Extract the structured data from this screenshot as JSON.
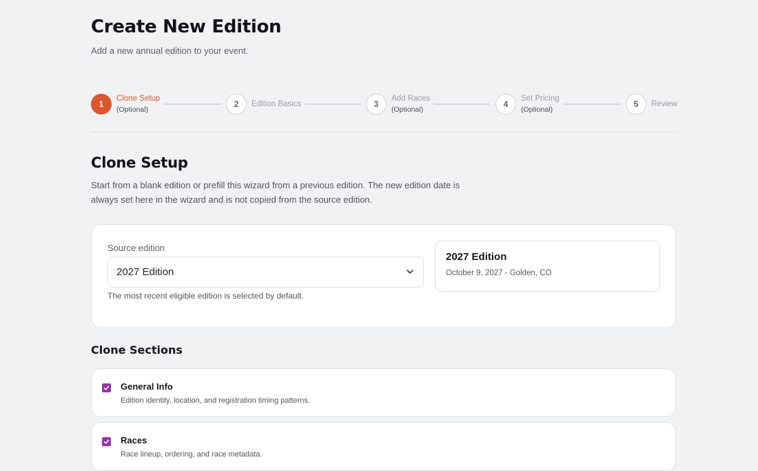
{
  "header": {
    "title": "Create New Edition",
    "subtitle": "Add a new annual edition to your event."
  },
  "stepper": {
    "active_color": "#e0542a",
    "steps": [
      {
        "number": "1",
        "label": "Clone Setup",
        "sub": "(Optional)",
        "state": "active"
      },
      {
        "number": "2",
        "label": "Edition Basics",
        "sub": "",
        "state": "pending"
      },
      {
        "number": "3",
        "label": "Add Races",
        "sub": "(Optional)",
        "state": "pending"
      },
      {
        "number": "4",
        "label": "Set Pricing",
        "sub": "(Optional)",
        "state": "pending"
      },
      {
        "number": "5",
        "label": "Review",
        "sub": "",
        "state": "pending"
      }
    ]
  },
  "clone_setup": {
    "title": "Clone Setup",
    "description": "Start from a blank edition or prefill this wizard from a previous edition. The new edition date is always set here in the wizard and is not copied from the source edition.",
    "source_label": "Source edition",
    "source_value": "2027 Edition",
    "source_icon": "chevron-down-icon",
    "helper": "The most recent eligible edition is selected by default.",
    "preview": {
      "title": "2027 Edition",
      "meta": "October 9, 2027 - Golden, CO"
    }
  },
  "clone_sections": {
    "title": "Clone Sections",
    "checkbox_color": "#9b2fae",
    "items": [
      {
        "title": "General Info",
        "description": "Edition identity, location, and registration timing patterns.",
        "checked": true
      },
      {
        "title": "Races",
        "description": "Race lineup, ordering, and race metadata.",
        "checked": true
      }
    ]
  }
}
